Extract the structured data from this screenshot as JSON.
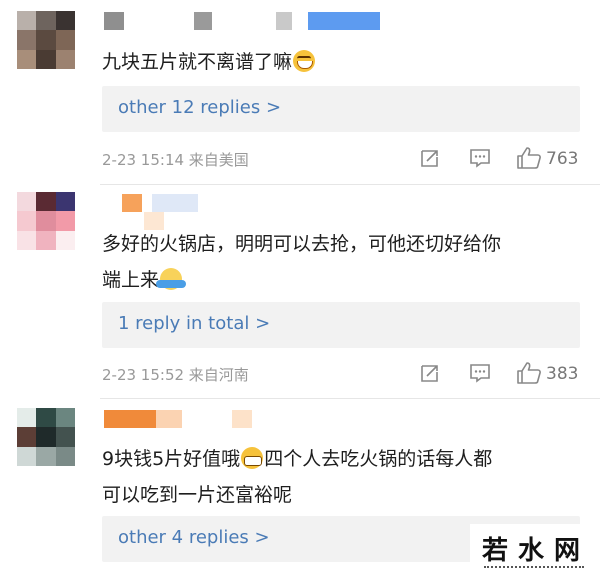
{
  "comments": [
    {
      "text": "九块五片就不离谱了嘛",
      "emoji": "laughing-face-icon",
      "replies_link": "other 12 replies >",
      "time": "2-23 15:14 来自美国",
      "likes": "763"
    },
    {
      "text_line1": "多好的火锅店，明明可以去抢，可他还切好给你",
      "text_line2": "端上来",
      "emoji": "shrug-face-icon",
      "replies_link": "1 reply in total >",
      "time": "2-23 15:52 来自河南",
      "likes": "383"
    },
    {
      "text_line1_a": "9块钱5片好值哦",
      "text_line1_b": "四个人去吃火锅的话每人都",
      "text_line2": "可以吃到一片还富裕呢",
      "emoji": "grinning-face-icon",
      "replies_link": "other 4 replies >"
    }
  ],
  "watermark": {
    "text": "若水网"
  },
  "colors": {
    "link": "#4a7bb6",
    "meta": "#999999",
    "reply_bg": "#f2f2f2"
  }
}
